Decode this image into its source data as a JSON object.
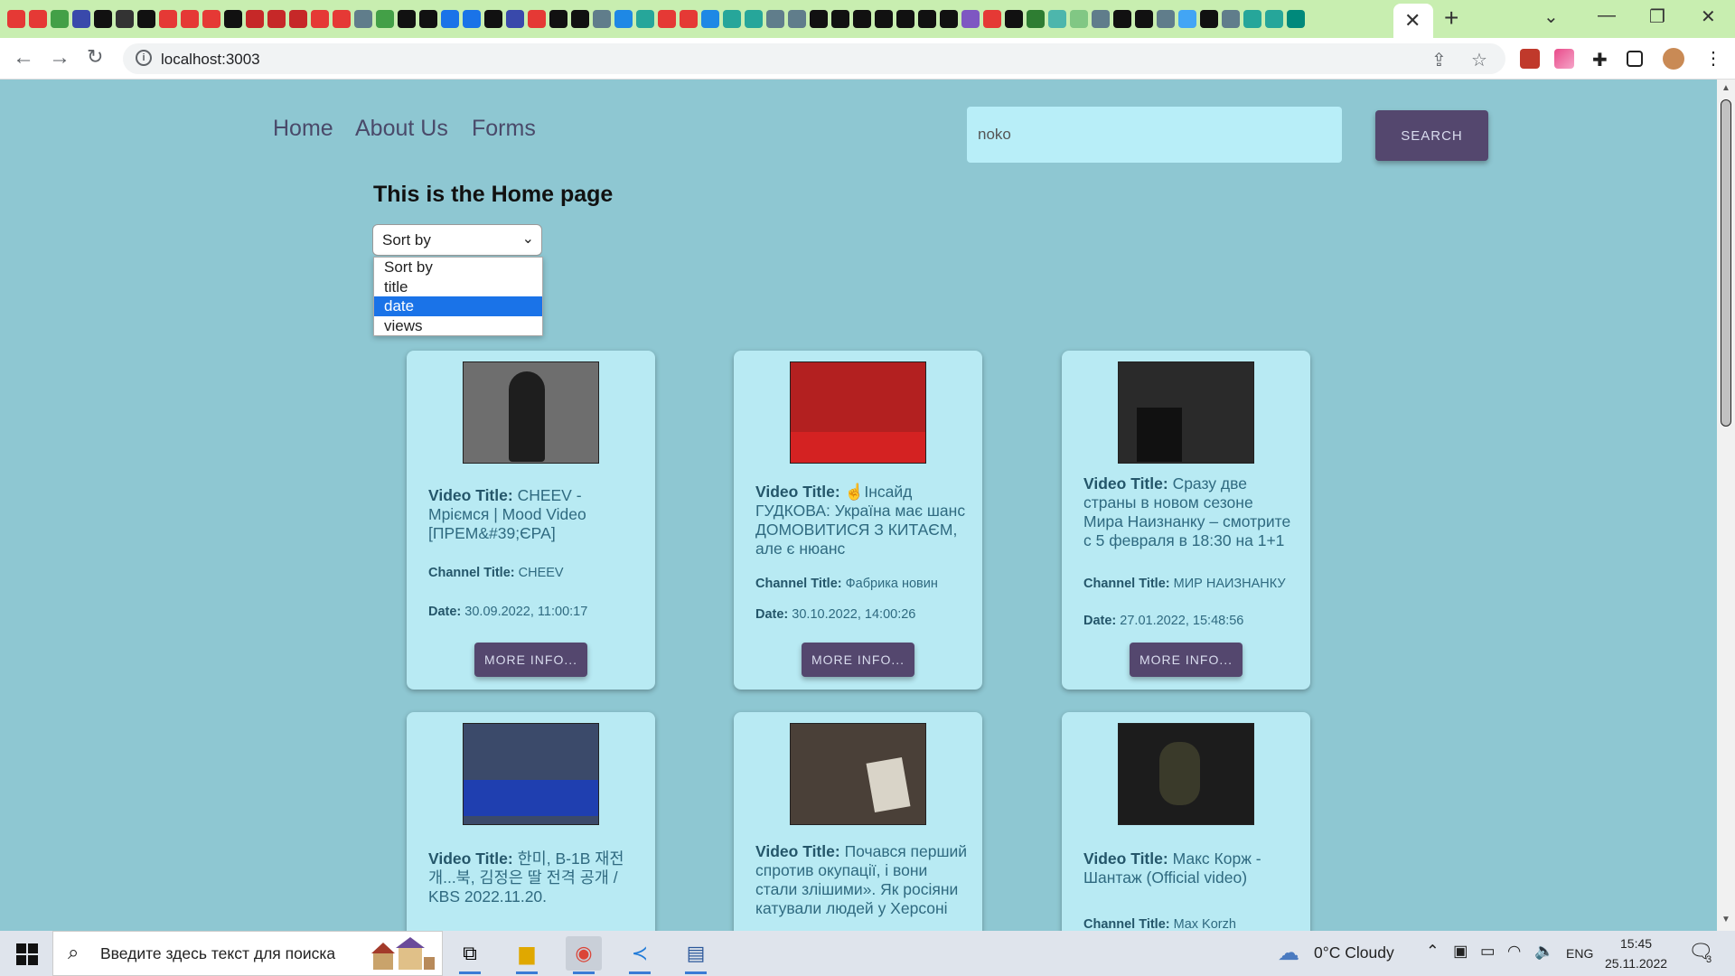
{
  "browser": {
    "url": "localhost:3003",
    "tab_close": "✕",
    "new_tab": "+",
    "window_controls": {
      "minimize": "—",
      "restore": "❐",
      "close": "✕",
      "tab_list": "⌄"
    }
  },
  "nav": {
    "home": "Home",
    "about": "About Us",
    "forms": "Forms"
  },
  "search": {
    "value": "noko",
    "button_label": "SEARCH"
  },
  "page_title": "This is the Home page",
  "sort": {
    "selected": "Sort by",
    "options": [
      "Sort by",
      "title",
      "date",
      "views"
    ],
    "highlighted": "date"
  },
  "labels": {
    "video_title": "Video Title:",
    "channel_title": "Channel Title:",
    "date": "Date:",
    "more_info": "MORE INFO..."
  },
  "videos": [
    {
      "title": "CHEEV - Мріємся | Mood Video [ПРЕМ&#39;ЄРА]",
      "channel": "CHEEV",
      "date": "30.09.2022, 11:00:17",
      "thumb_color": "#6e6e6e"
    },
    {
      "title": "☝Інсайд ГУДКОВА: Україна має шанс ДОМОВИТИСЯ З КИТАЄМ, але є нюанс",
      "channel": "Фабрика новин",
      "date": "30.10.2022, 14:00:26",
      "thumb_color": "#b32020"
    },
    {
      "title": "Сразу две страны в новом сезоне Мира Наизнанку – смотрите с 5 февраля в 18:30 на 1+1",
      "channel": "МИР НАИЗНАНКУ",
      "date": "27.01.2022, 15:48:56",
      "thumb_color": "#2a2a2a"
    },
    {
      "title": "한미, B-1B 재전개...북, 김정은 딸 전격 공개 / KBS 2022.11.20.",
      "channel": "",
      "date": "",
      "thumb_color": "#3b4a6a"
    },
    {
      "title": "Почався перший спротив окупації, і вони стали злішими». Як росіяни катували людей у Херсоні",
      "channel": "",
      "date": "",
      "thumb_color": "#4a4038"
    },
    {
      "title": "Макс Корж - Шантаж (Official video)",
      "channel": "Max Korzh",
      "date": "",
      "thumb_color": "#1c1c1c"
    }
  ],
  "taskbar": {
    "search_placeholder": "Введите здесь текст для поиска",
    "weather": "0°C  Cloudy",
    "language": "ENG",
    "time": "15:45",
    "date": "25.11.2022",
    "notifications": "3"
  },
  "colors": {
    "page_bg": "#8ec7d2",
    "card_bg": "#b8eaf3",
    "button_bg": "#54476e",
    "search_bg": "#b8eef8",
    "tab_bar_bg": "#c8eeb0"
  }
}
